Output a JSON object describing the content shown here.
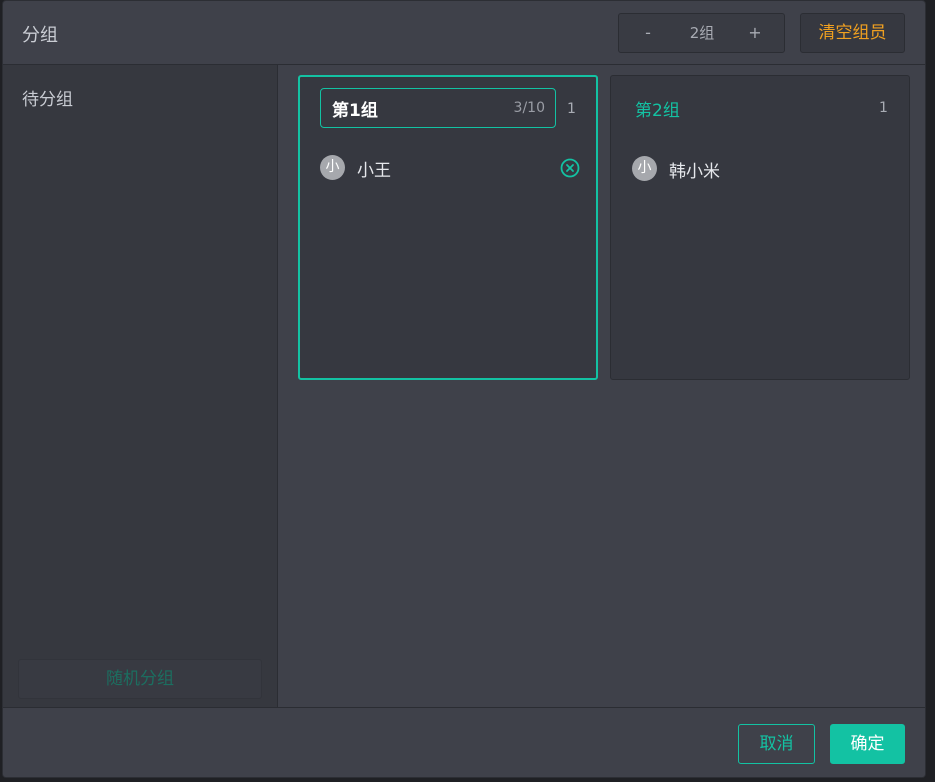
{
  "dialog": {
    "title": "分组"
  },
  "stepper": {
    "minus_label": "-",
    "value": "2组",
    "plus_label": "+"
  },
  "toolbar": {
    "clear_members_label": "清空组员"
  },
  "ungrouped": {
    "title": "待分组",
    "random_button_label": "随机分组"
  },
  "groups": [
    {
      "name": "第1组",
      "name_counter": "3/10",
      "count": "1",
      "members": [
        {
          "avatar": "小",
          "name": "小王"
        }
      ]
    },
    {
      "name": "第2组",
      "count": "1",
      "members": [
        {
          "avatar": "小",
          "name": "韩小米"
        }
      ]
    }
  ],
  "footer": {
    "cancel_label": "取消",
    "confirm_label": "确定"
  },
  "colors": {
    "accent": "#13c2a3",
    "warning": "#f0a020",
    "dialog_bg": "#3f414a",
    "panel_bg": "#36383f"
  },
  "icons": {
    "remove_member": "close-circle-icon"
  }
}
